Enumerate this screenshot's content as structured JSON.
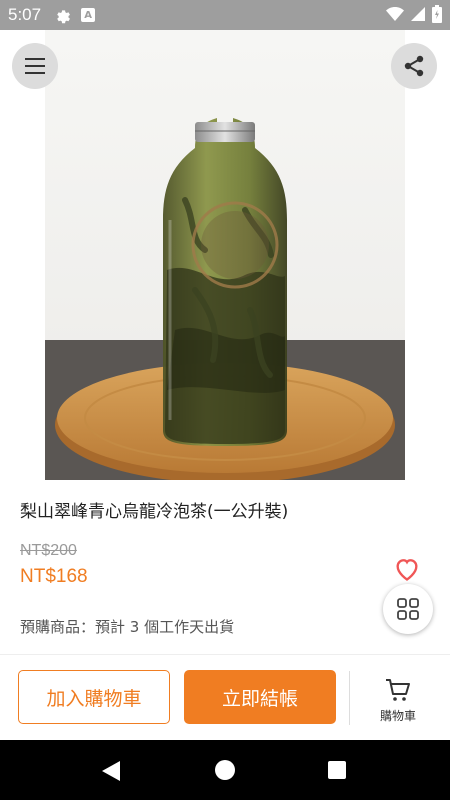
{
  "status_bar": {
    "time": "5:07",
    "a_badge": "A"
  },
  "product": {
    "title": "梨山翠峰青心烏龍冷泡茶(一公升裝)",
    "original_price": "NT$200",
    "sale_price": "NT$168",
    "note": "預購商品：預計 3 個工作天出貨"
  },
  "actions": {
    "add_to_cart": "加入購物車",
    "checkout": "立即結帳",
    "cart_label": "購物車"
  },
  "colors": {
    "accent": "#f07d22",
    "heart": "#f05656"
  }
}
